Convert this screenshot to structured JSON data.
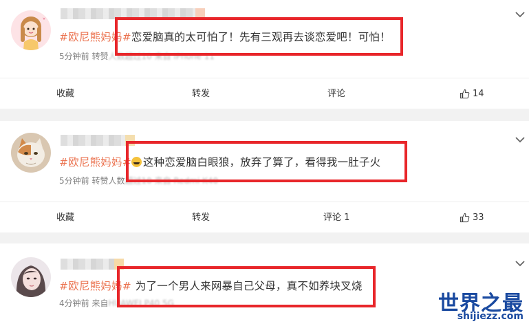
{
  "posts": [
    {
      "hashtag": "#欧尼熊妈妈#",
      "text": "恋爱脑真的太可怕了！先有三观再去谈恋爱吧！可怕！",
      "time": "5分钟前",
      "meta_visible": "转赞",
      "meta_blurred": "人数超过10  来自 iPhone 11",
      "actions": {
        "favorite": "收藏",
        "repost": "转发",
        "comment": "评论",
        "like_count": "14"
      },
      "avatar_icon": "cartoon-girl-avatar"
    },
    {
      "hashtag": "#欧尼熊妈妈#",
      "text": "这种恋爱脑白眼狼，放弃了算了，看得我一肚子火",
      "time": "5分钟前",
      "meta_visible": "转赞人数",
      "meta_blurred": "超过10  来自 Redmi K40",
      "actions": {
        "favorite": "收藏",
        "repost": "转发",
        "comment": "评论 1",
        "like_count": "33"
      },
      "avatar_icon": "cat-avatar"
    },
    {
      "hashtag": "#欧尼熊妈妈#",
      "text": "为了一个男人来网暴自己父母，真不如养块叉烧",
      "time": "4分钟前",
      "meta_visible": "来自",
      "meta_blurred": "HUAWEI P40 5G",
      "avatar_icon": "girl-photo-avatar"
    }
  ],
  "watermark": {
    "title": "世界之最",
    "url": "shijiezz.com"
  },
  "colors": {
    "hashtag": "#eb7350",
    "highlight_box": "#e8262a",
    "page_bg": "#f2f2f2"
  }
}
